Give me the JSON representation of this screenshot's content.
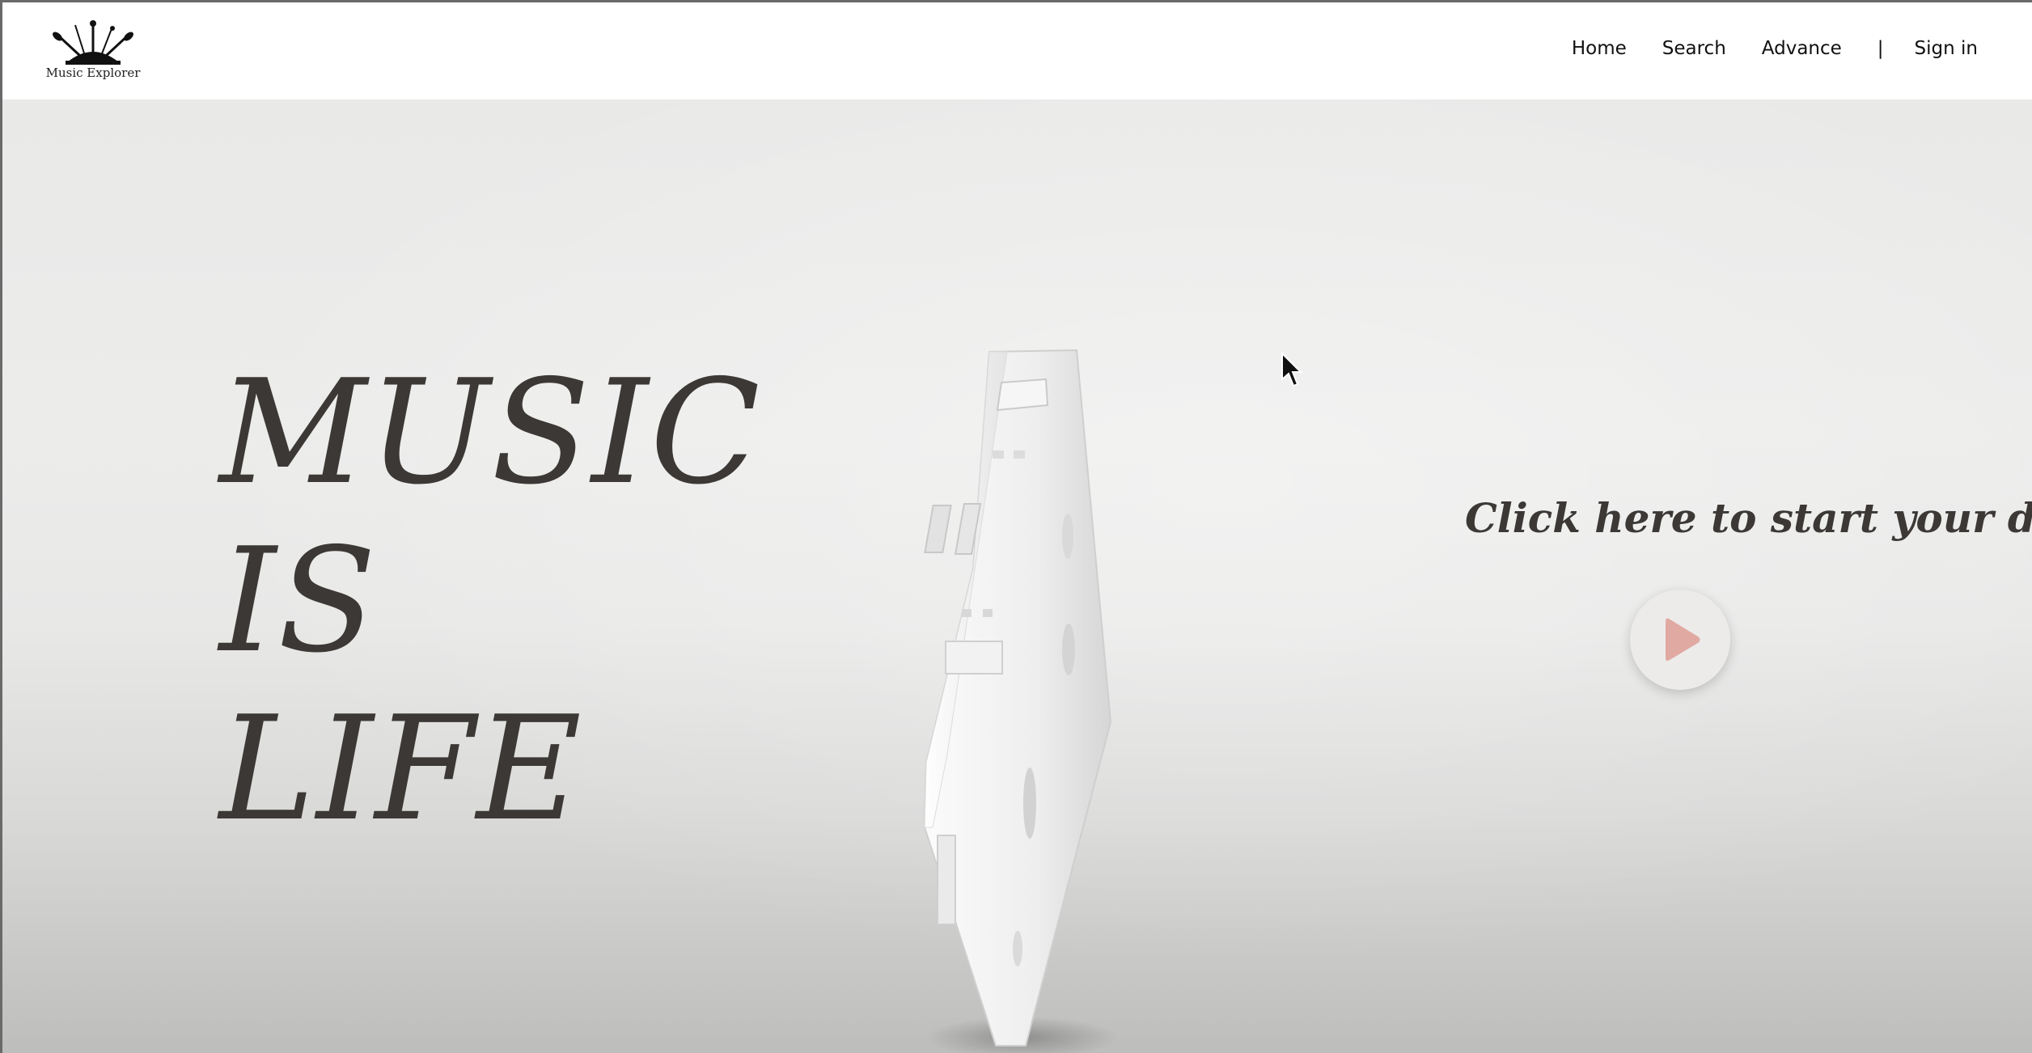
{
  "brand": {
    "name": "Music Explorer",
    "logo_icon": "crown-instruments-logo"
  },
  "nav": {
    "home": "Home",
    "search": "Search",
    "advance": "Advance",
    "separator": "|",
    "sign_in": "Sign in"
  },
  "hero": {
    "title_lines": [
      "MUSIC",
      "IS",
      "LIFE"
    ],
    "cta_text": "Click here to start your day",
    "play_icon": "play-icon",
    "background_image": "white cassette tape"
  },
  "colors": {
    "text_dark": "#3b3836",
    "play_accent": "#e0a9a1"
  }
}
